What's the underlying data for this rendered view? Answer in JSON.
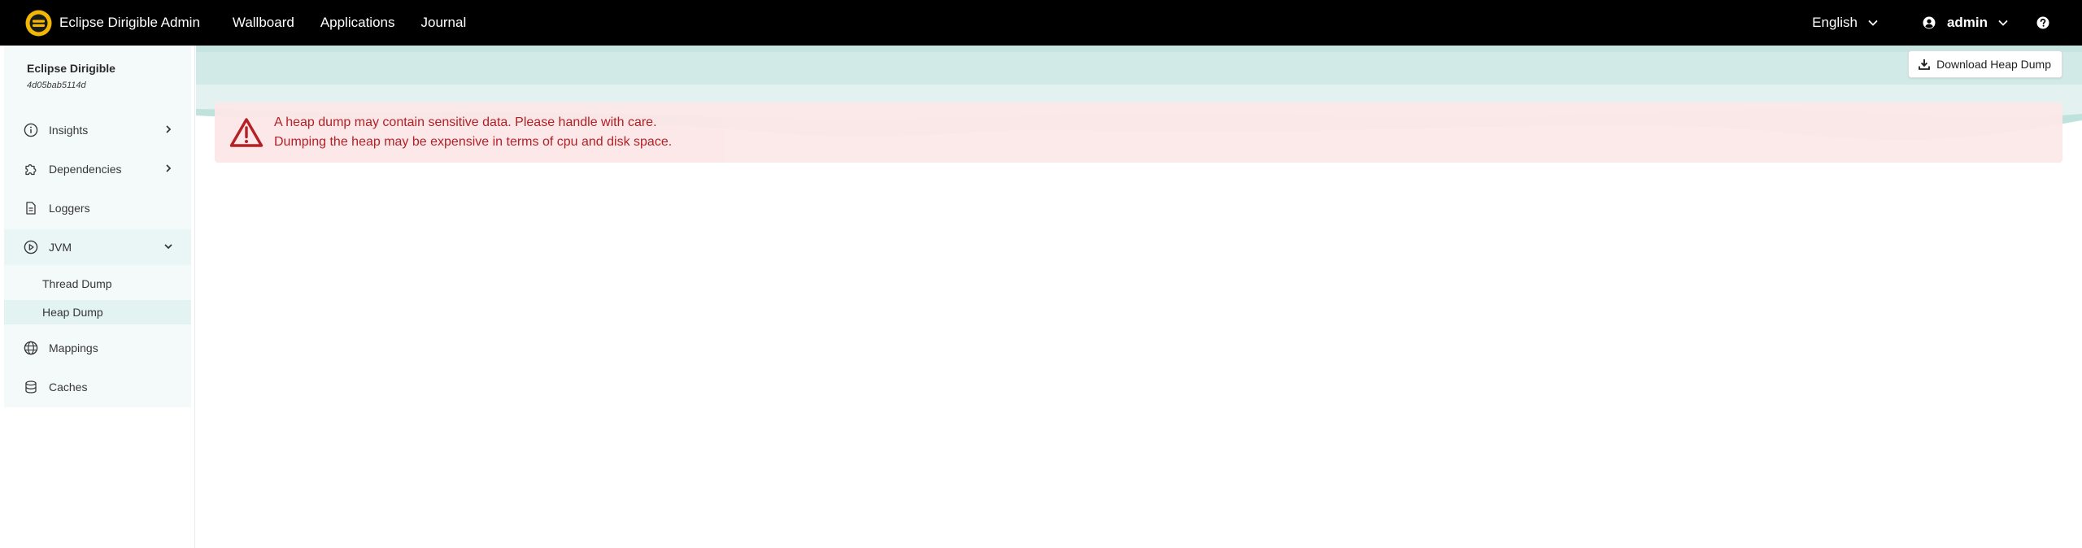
{
  "navbar": {
    "brand_title": "Eclipse Dirigible Admin",
    "links": [
      "Wallboard",
      "Applications",
      "Journal"
    ],
    "language": "English",
    "user": "admin"
  },
  "sidebar": {
    "title": "Eclipse Dirigible",
    "version": "4d05bab5114d",
    "items": {
      "insights": "Insights",
      "dependencies": "Dependencies",
      "loggers": "Loggers",
      "jvm": "JVM",
      "thread_dump": "Thread Dump",
      "heap_dump": "Heap Dump",
      "mappings": "Mappings",
      "caches": "Caches"
    }
  },
  "main": {
    "download_button": "Download Heap Dump",
    "alert_line1": "A heap dump may contain sensitive data. Please handle with care.",
    "alert_line2": "Dumping the heap may be expensive in terms of cpu and disk space."
  },
  "colors": {
    "navbar_bg": "#000000",
    "brand_yellow": "#f2b705",
    "alert_bg": "#fce8e8",
    "alert_text": "#b3161d",
    "header_teal": "#cfe9e6"
  },
  "icons": {
    "brand": "dirigible-logo-icon",
    "language": "chevron-down-icon",
    "user": "user-circle-icon",
    "help": "question-circle-icon",
    "insights": "info-circle-icon",
    "dependencies": "puzzle-icon",
    "loggers": "document-icon",
    "jvm": "play-circle-icon",
    "mappings": "globe-icon",
    "caches": "database-icon",
    "download": "download-icon",
    "alert": "warning-triangle-icon"
  }
}
